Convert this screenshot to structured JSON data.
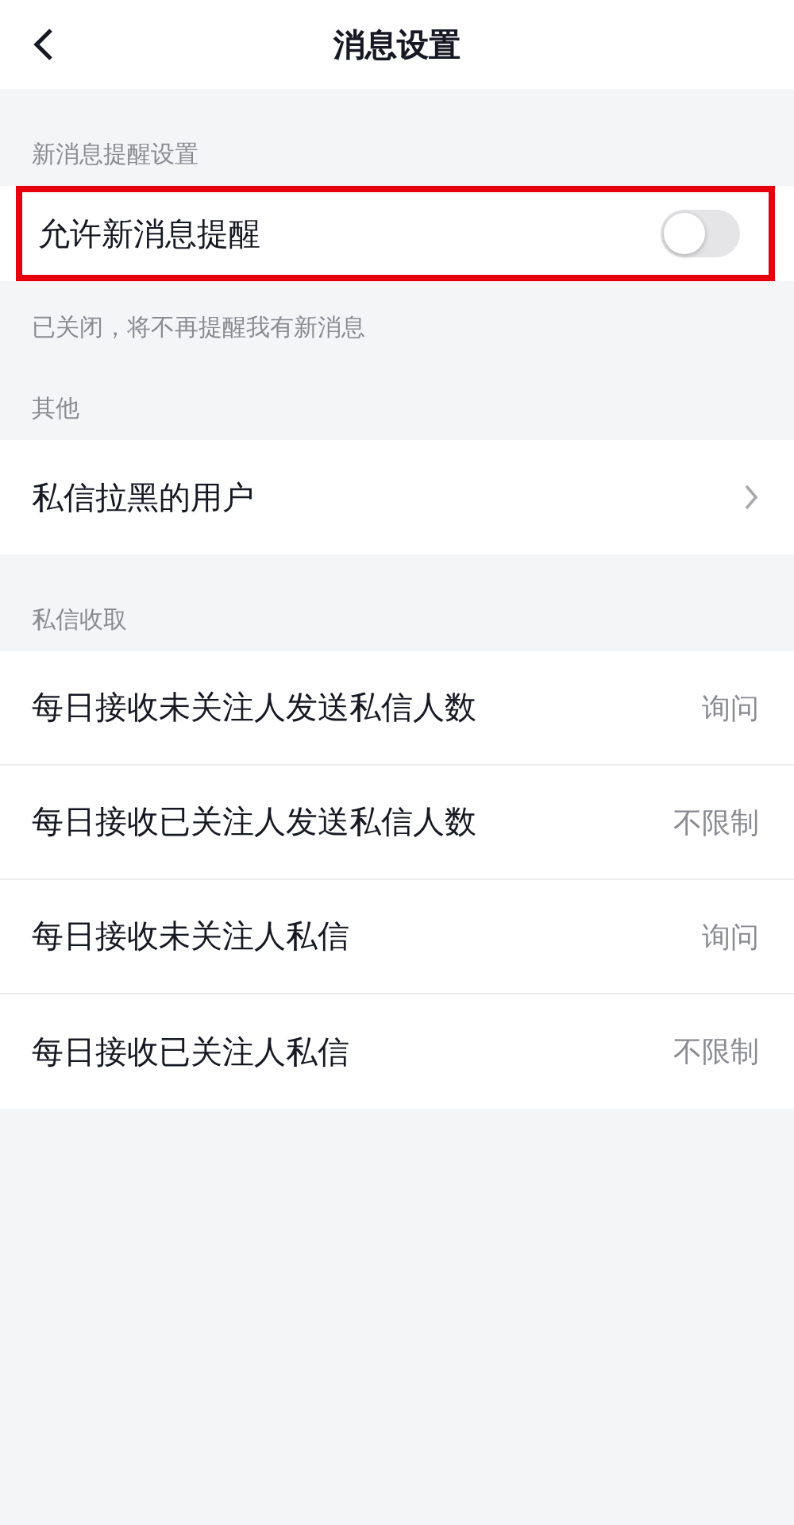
{
  "header": {
    "title": "消息设置"
  },
  "sections": [
    {
      "label": "新消息提醒设置",
      "rows": [
        {
          "kind": "toggle",
          "label": "允许新消息提醒",
          "on": false,
          "highlighted": true
        }
      ],
      "hint": "已关闭，将不再提醒我有新消息"
    },
    {
      "label": "其他",
      "rows": [
        {
          "kind": "link",
          "label": "私信拉黑的用户"
        }
      ]
    },
    {
      "label": "私信收取",
      "rows": [
        {
          "kind": "value",
          "label": "每日接收未关注人发送私信人数",
          "value": "询问"
        },
        {
          "kind": "value",
          "label": "每日接收已关注人发送私信人数",
          "value": "不限制"
        },
        {
          "kind": "value",
          "label": "每日接收未关注人私信",
          "value": "询问"
        },
        {
          "kind": "value",
          "label": "每日接收已关注人私信",
          "value": "不限制"
        }
      ]
    }
  ]
}
